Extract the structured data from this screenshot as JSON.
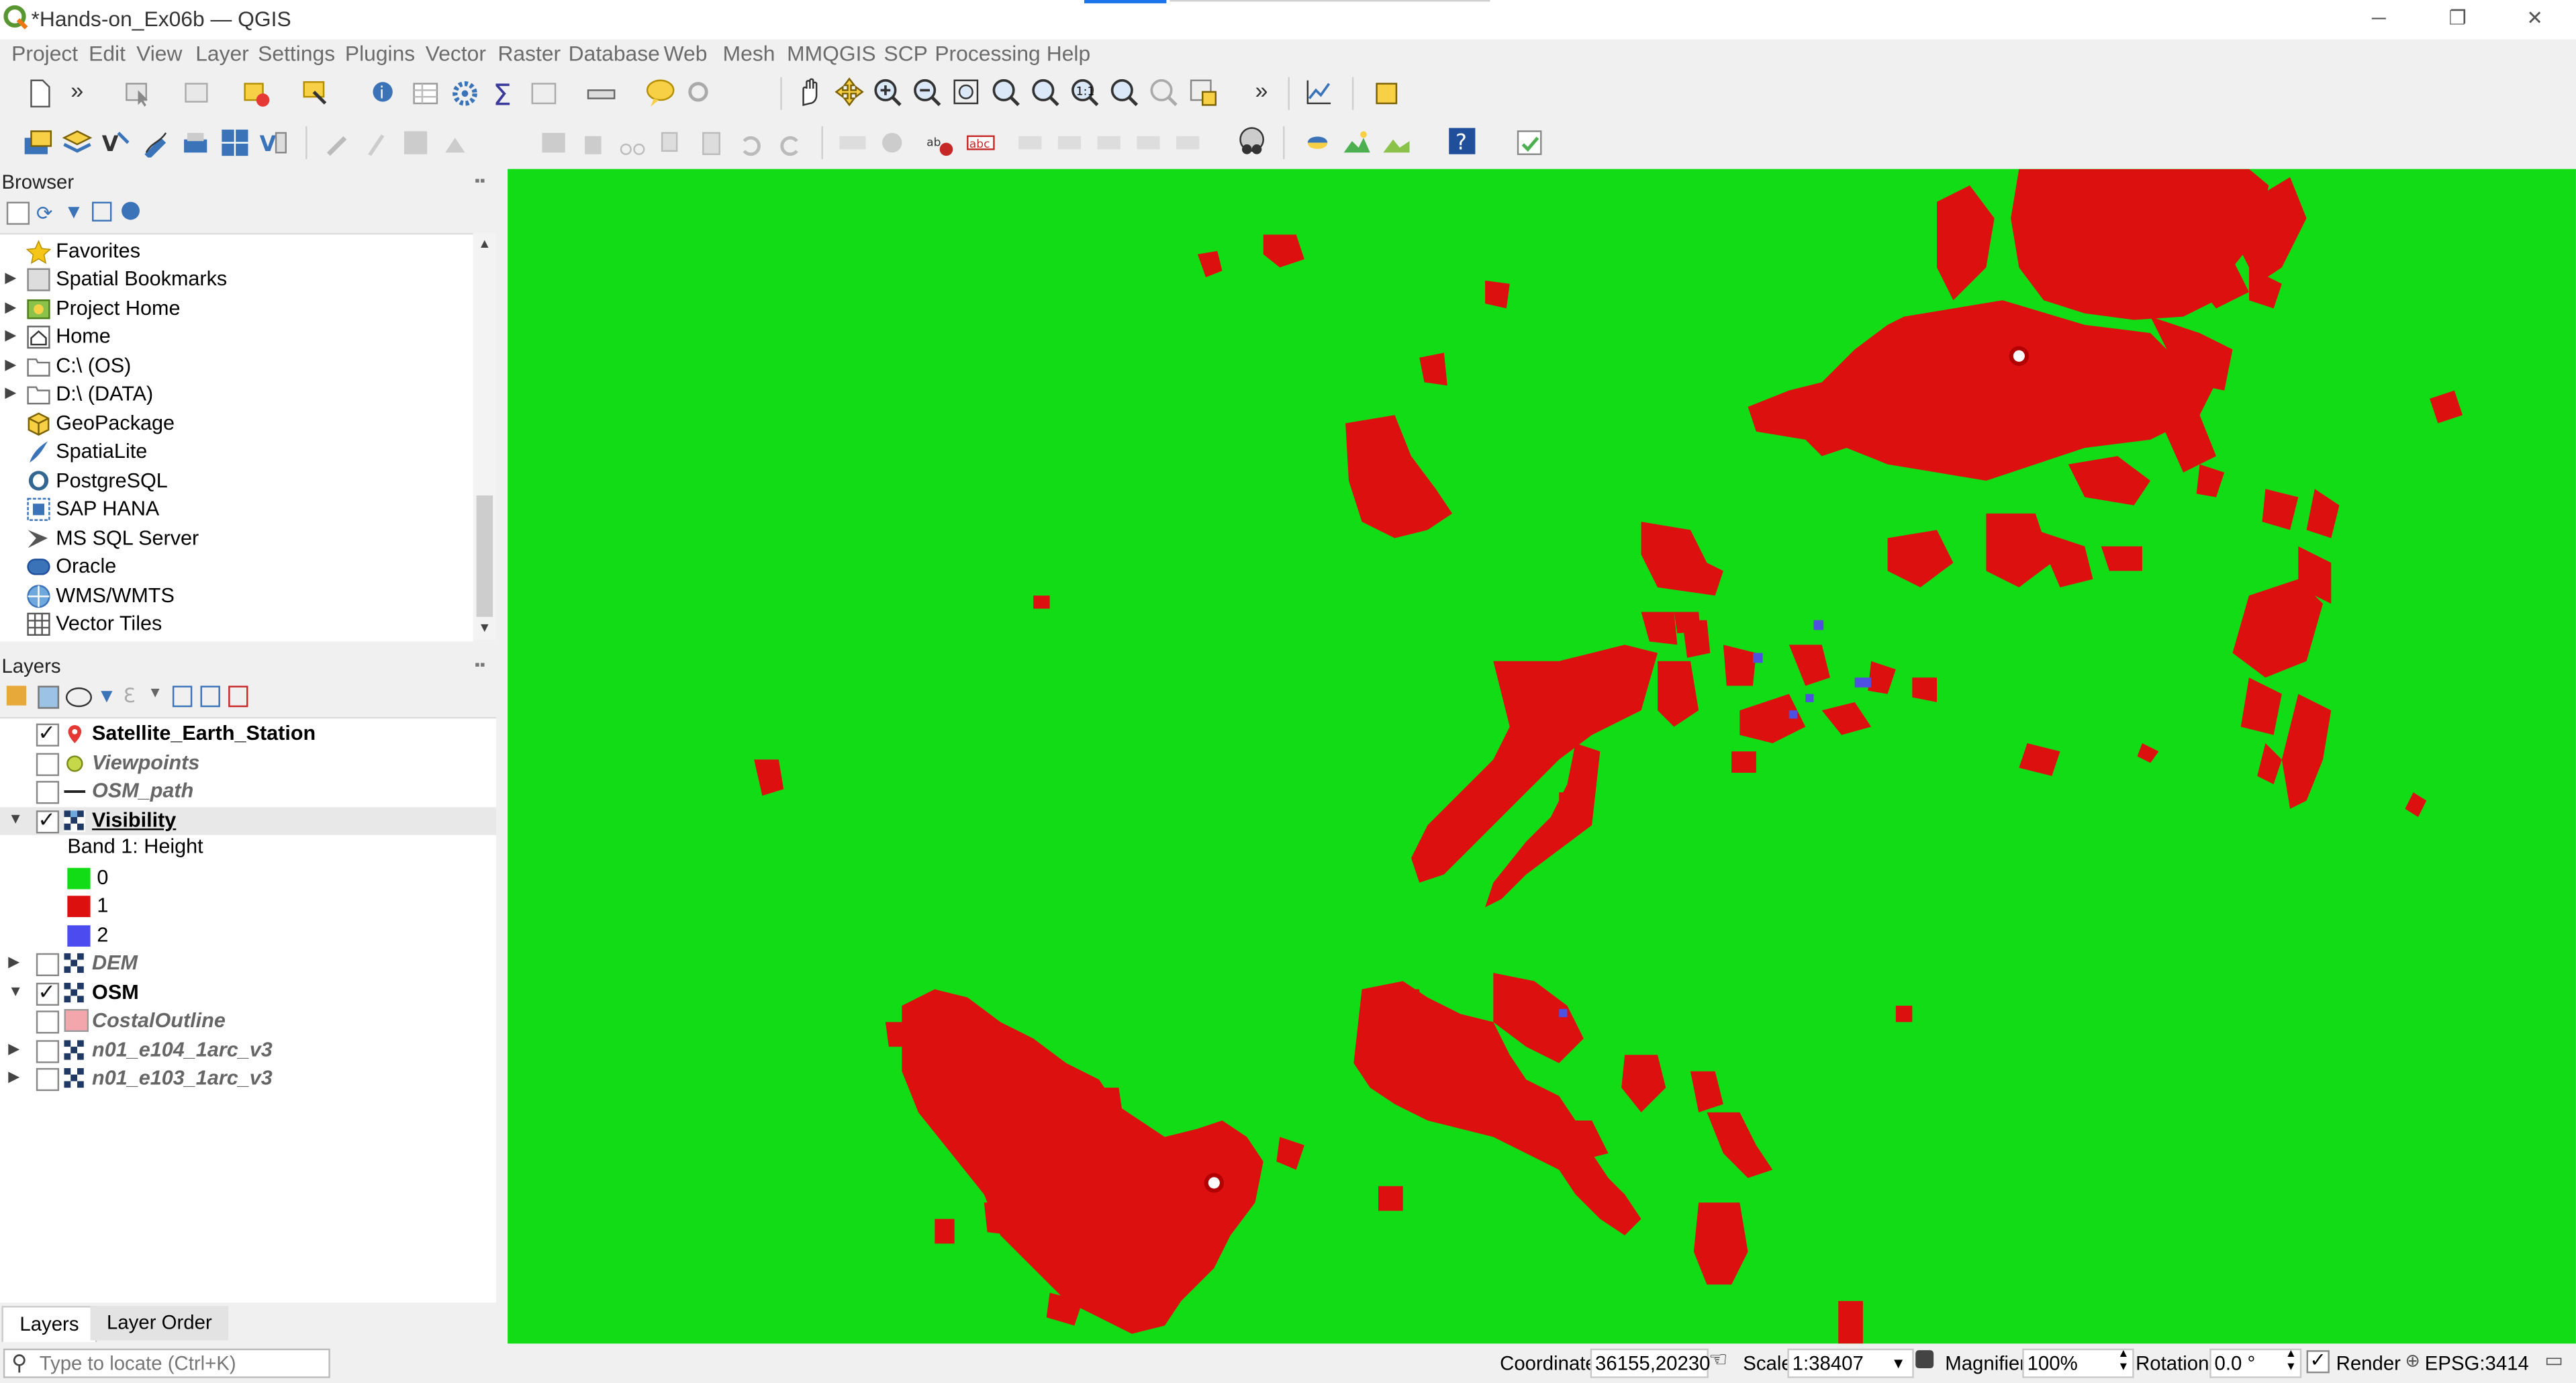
{
  "window": {
    "title": "*Hands-on_Ex06b — QGIS",
    "controls": [
      "─",
      "❐",
      "✕"
    ]
  },
  "menu": [
    "Project",
    "Edit",
    "View",
    "Layer",
    "Settings",
    "Plugins",
    "Vector",
    "Raster",
    "Database",
    "Web",
    "Mesh",
    "MMQGIS",
    "SCP",
    "Processing",
    "Help"
  ],
  "toolbar": {
    "overflow_label": "»"
  },
  "browser": {
    "title": "Browser",
    "items": [
      {
        "label": "Favorites",
        "icon": "star-icon",
        "expandable": false
      },
      {
        "label": "Spatial Bookmarks",
        "icon": "bookmark-icon",
        "expandable": true
      },
      {
        "label": "Project Home",
        "icon": "project-home-icon",
        "expandable": true
      },
      {
        "label": "Home",
        "icon": "home-icon",
        "expandable": true
      },
      {
        "label": "C:\\ (OS)",
        "icon": "drive-icon",
        "expandable": true
      },
      {
        "label": "D:\\ (DATA)",
        "icon": "drive-icon",
        "expandable": true
      },
      {
        "label": "GeoPackage",
        "icon": "geopackage-icon",
        "expandable": false
      },
      {
        "label": "SpatiaLite",
        "icon": "spatialite-icon",
        "expandable": false
      },
      {
        "label": "PostgreSQL",
        "icon": "postgresql-icon",
        "expandable": false
      },
      {
        "label": "SAP HANA",
        "icon": "sap-hana-icon",
        "expandable": false
      },
      {
        "label": "MS SQL Server",
        "icon": "mssql-icon",
        "expandable": false
      },
      {
        "label": "Oracle",
        "icon": "oracle-icon",
        "expandable": false
      },
      {
        "label": "WMS/WMTS",
        "icon": "wms-icon",
        "expandable": false
      },
      {
        "label": "Vector Tiles",
        "icon": "vector-tiles-icon",
        "expandable": false
      }
    ]
  },
  "layers": {
    "title": "Layers",
    "items": [
      {
        "label": "Satellite_Earth_Station",
        "checked": true,
        "style": "bold",
        "icon": "point-icon",
        "expand": ""
      },
      {
        "label": "Viewpoints",
        "checked": false,
        "style": "italic",
        "icon": "circle-point-icon",
        "expand": ""
      },
      {
        "label": "OSM_path",
        "checked": false,
        "style": "italic",
        "icon": "line-icon",
        "expand": ""
      },
      {
        "label": "Visibility",
        "checked": true,
        "style": "bold underline",
        "icon": "raster-icon",
        "expand": "▼",
        "selected": true
      },
      {
        "label": "DEM",
        "checked": false,
        "style": "italic",
        "icon": "raster-icon",
        "expand": "▶"
      },
      {
        "label": "OSM",
        "checked": true,
        "style": "bold",
        "icon": "raster-icon",
        "expand": "▼"
      },
      {
        "label": "CostalOutline",
        "checked": false,
        "style": "italic",
        "icon": "polygon-icon",
        "expand": ""
      },
      {
        "label": "n01_e104_1arc_v3",
        "checked": false,
        "style": "italic",
        "icon": "raster-icon",
        "expand": "▶"
      },
      {
        "label": "n01_e103_1arc_v3",
        "checked": false,
        "style": "italic",
        "icon": "raster-icon",
        "expand": "▶"
      }
    ],
    "legend": {
      "band_label": "Band 1: Height",
      "classes": [
        {
          "value": "0",
          "color": "#12dc15"
        },
        {
          "value": "1",
          "color": "#dd1010"
        },
        {
          "value": "2",
          "color": "#4b4bf0"
        }
      ]
    },
    "tabs": [
      "Layers",
      "Layer Order"
    ]
  },
  "map": {
    "background_color": "#12dc15",
    "visible_color": "#dd1010",
    "class2_color": "#5050e0"
  },
  "status": {
    "locate_placeholder": "Type to locate (Ctrl+K)",
    "coordinate_label": "Coordinate",
    "coordinate_value": "36155,20230",
    "scale_label": "Scale",
    "scale_value": "1:38407",
    "magnifier_label": "Magnifier",
    "magnifier_value": "100%",
    "rotation_label": "Rotation",
    "rotation_value": "0.0 °",
    "render_label": "Render",
    "crs": "EPSG:3414"
  }
}
